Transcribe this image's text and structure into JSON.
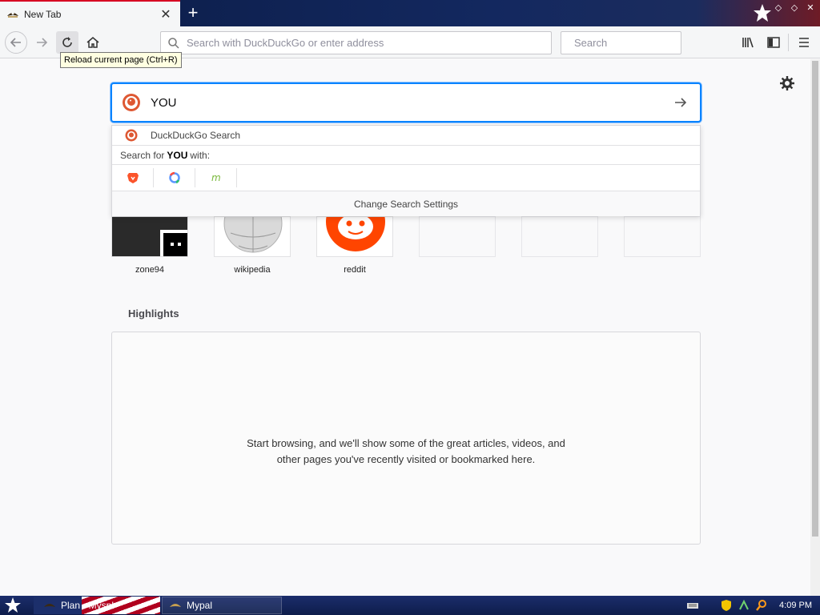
{
  "colors": {
    "accent": "#0a84ff",
    "tab_border": "#d70022",
    "taskbar": "#0e1d4b"
  },
  "tab": {
    "title": "New Tab",
    "favicon": "pirate-hat-icon"
  },
  "toolbar": {
    "url_placeholder": "Search with DuckDuckGo or enter address",
    "search_placeholder": "Search",
    "tooltip": "Reload current page (Ctrl+R)"
  },
  "newtab": {
    "search_value": "YOU",
    "dropdown": {
      "engine_row": "DuckDuckGo Search",
      "search_for_prefix": "Search for",
      "search_for_term": "YOU",
      "search_for_suffix": "with:",
      "engines": [
        "brave-icon",
        "qwant-icon",
        "mojeek-icon"
      ],
      "settings": "Change Search Settings"
    },
    "top_sites": [
      {
        "label": "zone94",
        "icon": "zone94-thumbnail"
      },
      {
        "label": "wikipedia",
        "icon": "wikipedia-globe-icon"
      },
      {
        "label": "reddit",
        "icon": "reddit-alien-icon"
      },
      {
        "label": ""
      },
      {
        "label": ""
      },
      {
        "label": ""
      }
    ],
    "highlights_title": "Highlights",
    "highlights_message": "Start browsing, and we'll show some of the great articles, videos, and other pages you've recently visited or bookmarked here."
  },
  "taskbar": {
    "items": [
      "Plan - Myspl",
      "Mypal"
    ],
    "clock": "4:09 PM"
  }
}
